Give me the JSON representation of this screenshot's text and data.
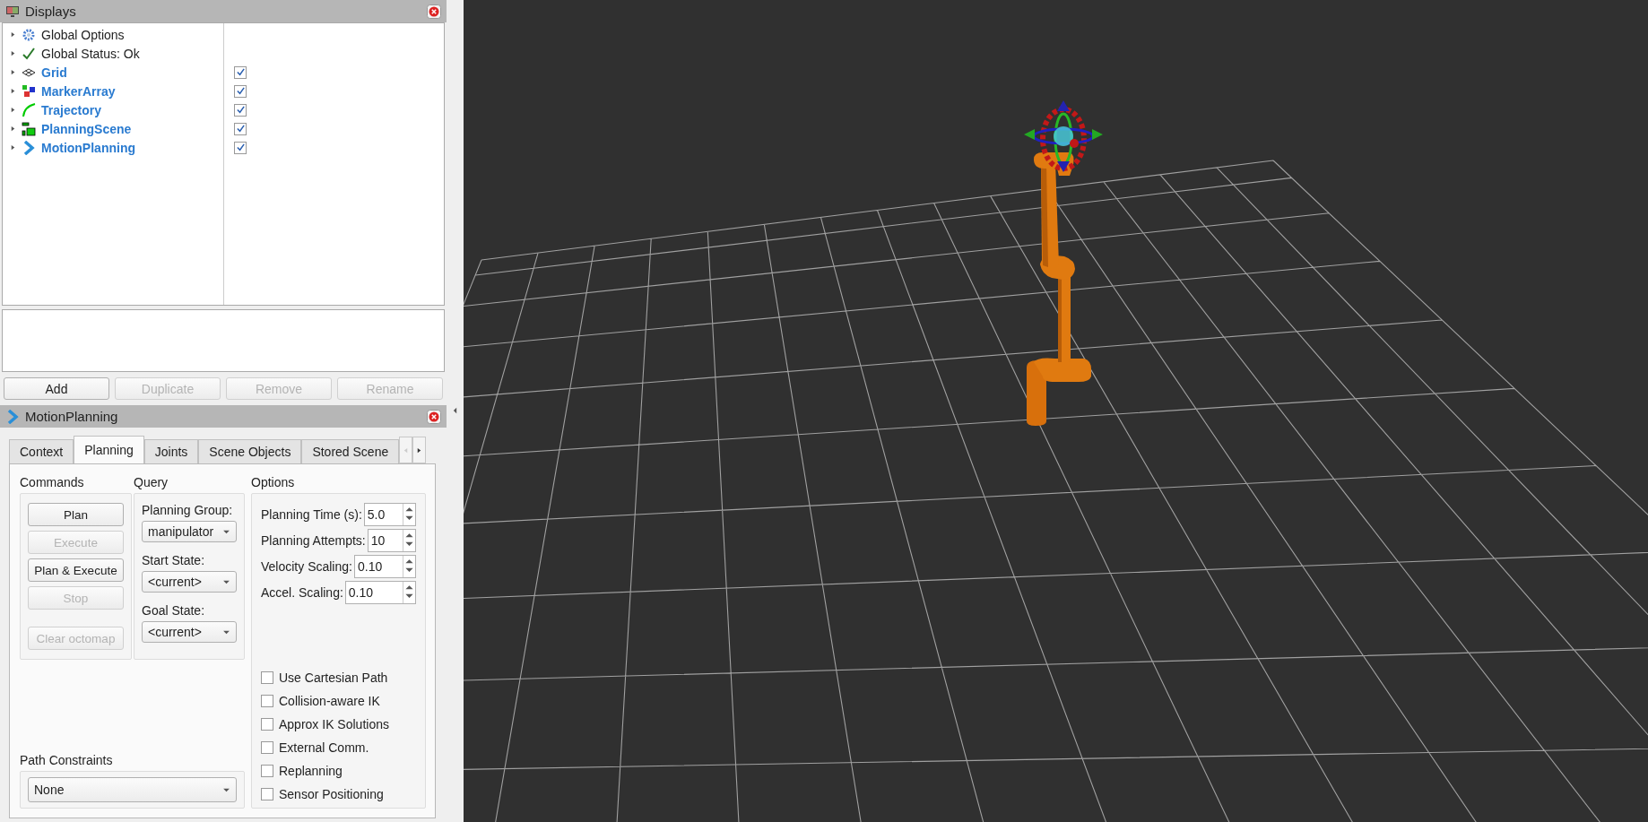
{
  "displays": {
    "title": "Displays",
    "items": [
      {
        "label": "Global Options",
        "kind": "options"
      },
      {
        "label": "Global Status: Ok",
        "kind": "status"
      },
      {
        "label": "Grid",
        "kind": "display",
        "checked": true
      },
      {
        "label": "MarkerArray",
        "kind": "display",
        "checked": true
      },
      {
        "label": "Trajectory",
        "kind": "display",
        "checked": true
      },
      {
        "label": "PlanningScene",
        "kind": "display",
        "checked": true
      },
      {
        "label": "MotionPlanning",
        "kind": "display",
        "checked": true
      }
    ]
  },
  "display_buttons": [
    {
      "label": "Add",
      "disabled": false
    },
    {
      "label": "Duplicate",
      "disabled": true
    },
    {
      "label": "Remove",
      "disabled": true
    },
    {
      "label": "Rename",
      "disabled": true
    }
  ],
  "motion_planning": {
    "title": "MotionPlanning",
    "tabs": [
      {
        "label": "Context",
        "selected": false
      },
      {
        "label": "Planning",
        "selected": true
      },
      {
        "label": "Joints",
        "selected": false
      },
      {
        "label": "Scene Objects",
        "selected": false
      },
      {
        "label": "Stored Scene",
        "selected": false
      }
    ],
    "commands": {
      "title": "Commands",
      "buttons": [
        {
          "label": "Plan",
          "disabled": false
        },
        {
          "label": "Execute",
          "disabled": true
        },
        {
          "label": "Plan & Execute",
          "disabled": false
        },
        {
          "label": "Stop",
          "disabled": true
        },
        {
          "label": "Clear octomap",
          "disabled": true
        }
      ]
    },
    "query": {
      "title": "Query",
      "fields": [
        {
          "label": "Planning Group:",
          "value": "manipulator"
        },
        {
          "label": "Start State:",
          "value": "<current>"
        },
        {
          "label": "Goal State:",
          "value": "<current>"
        }
      ]
    },
    "options": {
      "title": "Options",
      "spinboxes": [
        {
          "label": "Planning Time (s):",
          "value": "5.0"
        },
        {
          "label": "Planning Attempts:",
          "value": "10"
        },
        {
          "label": "Velocity Scaling:",
          "value": "0.10"
        },
        {
          "label": "Accel. Scaling:",
          "value": "0.10"
        }
      ],
      "checkboxes": [
        {
          "label": "Use Cartesian Path",
          "checked": false
        },
        {
          "label": "Collision-aware IK",
          "checked": false
        },
        {
          "label": "Approx IK Solutions",
          "checked": false
        },
        {
          "label": "External Comm.",
          "checked": false
        },
        {
          "label": "Replanning",
          "checked": false
        },
        {
          "label": "Sensor Positioning",
          "checked": false
        }
      ]
    },
    "path_constraints": {
      "title": "Path Constraints",
      "value": "None"
    }
  }
}
